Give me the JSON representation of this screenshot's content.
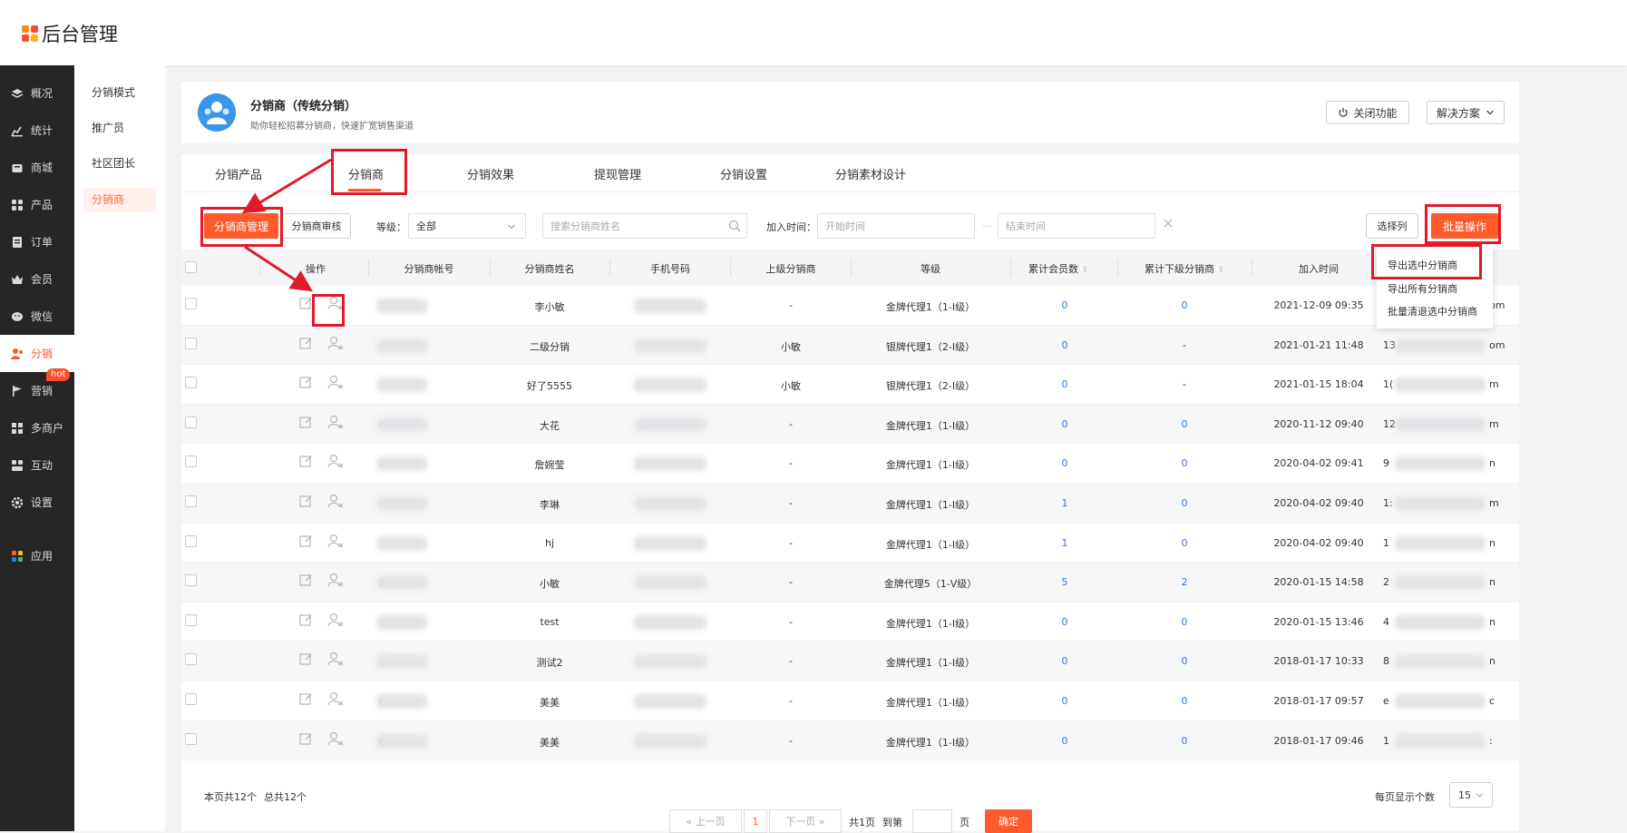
{
  "app": {
    "title": "后台管理"
  },
  "sidebar": {
    "items": [
      {
        "label": "概况",
        "icon": "layers-icon"
      },
      {
        "label": "统计",
        "icon": "chart-icon"
      },
      {
        "label": "商城",
        "icon": "store-icon"
      },
      {
        "label": "产品",
        "icon": "grid-icon"
      },
      {
        "label": "订单",
        "icon": "order-icon"
      },
      {
        "label": "会员",
        "icon": "crown-icon"
      },
      {
        "label": "微信",
        "icon": "wechat-icon"
      },
      {
        "label": "分销",
        "icon": "distribution-icon"
      },
      {
        "label": "营销",
        "icon": "flag-icon"
      },
      {
        "label": "多商户",
        "icon": "merchant-icon"
      },
      {
        "label": "互动",
        "icon": "interact-icon"
      },
      {
        "label": "设置",
        "icon": "gear-icon"
      },
      {
        "label": "应用",
        "icon": "apps-icon"
      }
    ],
    "hot_badge": "hot"
  },
  "subnav": {
    "items": [
      "分销模式",
      "推广员",
      "社区团长",
      "分销商"
    ]
  },
  "header": {
    "title": "分销商（传统分销）",
    "subtitle": "助你轻松招募分销商，快速扩宽销售渠道",
    "close_feature": "关闭功能",
    "solution": "解决方案"
  },
  "tabs": [
    "分销产品",
    "分销商",
    "分销效果",
    "提现管理",
    "分销设置",
    "分销素材设计"
  ],
  "toolbar": {
    "manage": "分销商管理",
    "review": "分销商审核",
    "level_label": "等级：",
    "level_value": "全部",
    "search_placeholder": "搜索分销商姓名",
    "join_time_label": "加入时间：",
    "start_placeholder": "开始时间",
    "range_sep": "—",
    "end_placeholder": "结束时间",
    "select_columns": "选择列",
    "batch": "批量操作"
  },
  "dropdown": [
    "导出选中分销商",
    "导出所有分销商",
    "批量清退选中分销商"
  ],
  "table": {
    "headers": [
      "操作",
      "分销商帐号",
      "分销商姓名",
      "手机号码",
      "上级分销商",
      "等级",
      "累计会员数",
      "累计下级分销商",
      "加入时间"
    ],
    "rows": [
      {
        "acct": "",
        "name": "李小敏",
        "parent": "-",
        "level": "金牌代理1（1-I级）",
        "members": "0",
        "subs": "0",
        "time": "2021-12-09 09:35",
        "tail": "om"
      },
      {
        "acct": "",
        "name": "二级分销",
        "parent": "小敏",
        "level": "银牌代理1（2-I级）",
        "members": "0",
        "subs": "-",
        "time": "2021-01-21 11:48",
        "tail": "13",
        "tail2": "om"
      },
      {
        "acct": "",
        "name": "好了5555",
        "parent": "小敏",
        "level": "银牌代理1（2-I级）",
        "members": "0",
        "subs": "-",
        "time": "2021-01-15 18:04",
        "tail": "1(",
        "tail2": "m"
      },
      {
        "acct": "c",
        "name": "大花",
        "parent": "-",
        "level": "金牌代理1（1-I级）",
        "members": "0",
        "subs": "0",
        "time": "2020-11-12 09:40",
        "tail": "12",
        "tail2": "m"
      },
      {
        "acct": "z",
        "name": "詹婉莹",
        "parent": "-",
        "level": "金牌代理1（1-I级）",
        "members": "0",
        "subs": "0",
        "time": "2020-04-02 09:41",
        "tail": "9",
        "tail2": "n"
      },
      {
        "acct": "",
        "name": "李琳",
        "parent": "-",
        "level": "金牌代理1（1-I级）",
        "members": "1",
        "subs": "0",
        "time": "2020-04-02 09:40",
        "tail": "1:",
        "tail2": "m"
      },
      {
        "acct": "",
        "name": "hj",
        "parent": "-",
        "level": "金牌代理1（1-I级）",
        "members": "1",
        "subs": "0",
        "time": "2020-04-02 09:40",
        "tail": "1",
        "tail2": "n"
      },
      {
        "acct": "x",
        "name": "小敏",
        "parent": "-",
        "level": "金牌代理5（1-V级）",
        "members": "5",
        "subs": "2",
        "time": "2020-01-15 14:58",
        "tail": "2",
        "tail2": "n"
      },
      {
        "acct": "",
        "name": "test",
        "parent": "-",
        "level": "金牌代理1（1-I级）",
        "members": "0",
        "subs": "0",
        "time": "2020-01-15 13:46",
        "tail": "4",
        "tail2": "n"
      },
      {
        "acct": "",
        "name": "测试2",
        "parent": "-",
        "level": "金牌代理1（1-I级）",
        "members": "0",
        "subs": "0",
        "time": "2018-01-17 10:33",
        "tail": "8",
        "tail2": "n"
      },
      {
        "acct": "n",
        "name": "美美",
        "parent": "-",
        "level": "金牌代理1（1-I级）",
        "members": "0",
        "subs": "0",
        "time": "2018-01-17 09:57",
        "tail": "e",
        "tail2": "c"
      },
      {
        "acct": "n",
        "name": "美美",
        "parent": "-",
        "level": "金牌代理1（1-I级）",
        "members": "0",
        "subs": "0",
        "time": "2018-01-17 09:46",
        "tail": "1",
        "tail2": ":"
      }
    ]
  },
  "footer": {
    "page_count": "本页共12个",
    "total": "总共12个",
    "prev": "上一页",
    "current": "1",
    "next": "下一页",
    "pages": "共1页",
    "goto": "到第",
    "page_unit": "页",
    "confirm": "确定",
    "per_page_label": "每页显示个数",
    "per_page": "15"
  },
  "colors": {
    "accent": "#ff5a2c",
    "link": "#2d7ae5",
    "annotation": "#e0192b",
    "sidebar": "#262626"
  }
}
